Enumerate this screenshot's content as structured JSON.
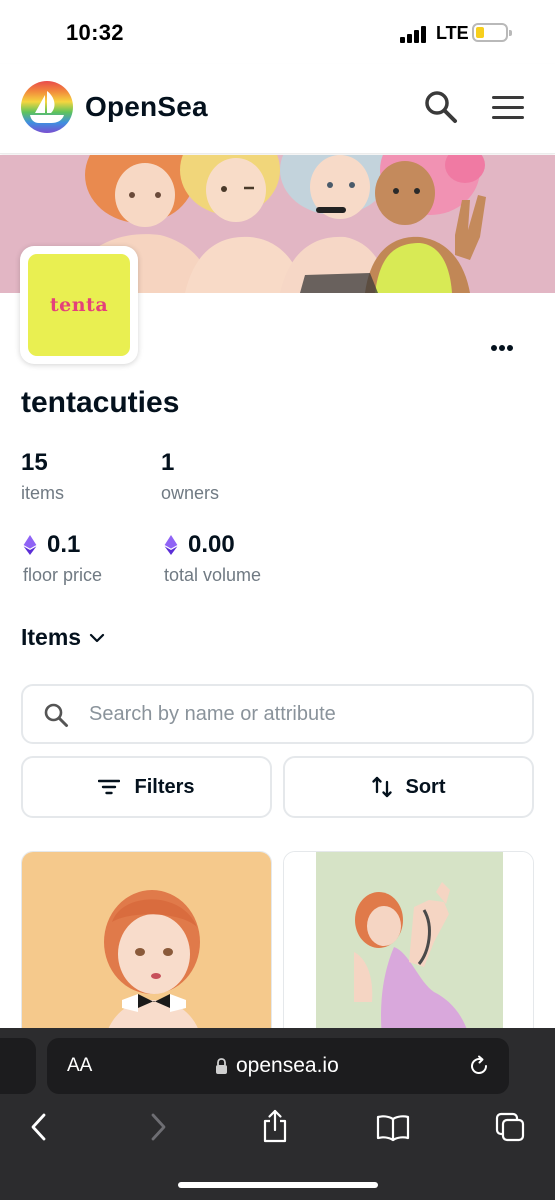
{
  "status_bar": {
    "time": "10:32",
    "network": "LTE"
  },
  "header": {
    "brand": "OpenSea"
  },
  "collection": {
    "avatar_text": "tenta",
    "name": "tentacuties",
    "stats": [
      {
        "value": "15",
        "label": "items",
        "eth": false
      },
      {
        "value": "1",
        "label": "owners",
        "eth": false
      },
      {
        "value": "0.1",
        "label": "floor price",
        "eth": true
      },
      {
        "value": "0.00",
        "label": "total volume",
        "eth": true
      }
    ]
  },
  "items_section": {
    "dropdown_label": "Items",
    "search_placeholder": "Search by name or attribute",
    "filters_label": "Filters",
    "sort_label": "Sort"
  },
  "browser": {
    "aa_label": "AA",
    "url": "opensea.io"
  },
  "colors": {
    "brand_dark": "#04111d",
    "muted": "#707a83",
    "ether": "#6f3ff5",
    "avatar_bg": "#e9ef51",
    "avatar_text": "#e4417a"
  }
}
